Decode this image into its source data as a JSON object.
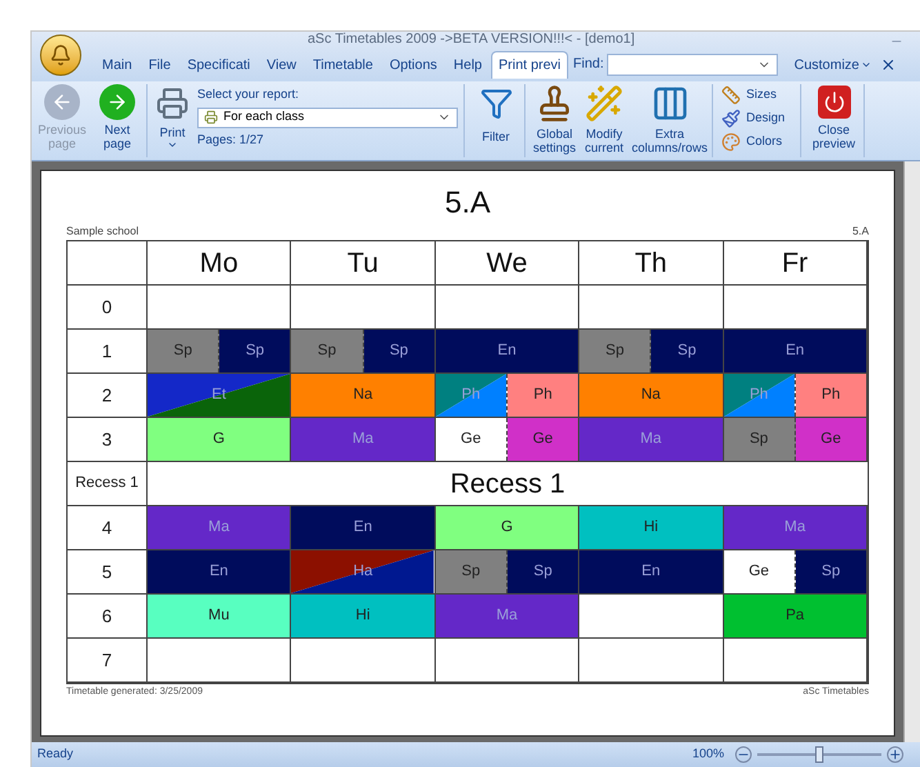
{
  "window": {
    "title": "aSc Timetables 2009 ->BETA VERSION!!!< - [demo1]"
  },
  "menu_tabs": [
    {
      "label": "Main",
      "selected": false
    },
    {
      "label": "File",
      "selected": false
    },
    {
      "label": "Specificati",
      "selected": false
    },
    {
      "label": "View",
      "selected": false
    },
    {
      "label": "Timetable",
      "selected": false
    },
    {
      "label": "Options",
      "selected": false
    },
    {
      "label": "Help",
      "selected": false
    },
    {
      "label": "Print previ",
      "selected": true
    }
  ],
  "find": {
    "label": "Find:"
  },
  "customize": {
    "label": "Customize"
  },
  "ribbon": {
    "nav": [
      {
        "kind": "previous",
        "label": "Previous page",
        "disabled": true
      },
      {
        "kind": "next",
        "label": "Next page",
        "disabled": false
      }
    ],
    "print": {
      "label": "Print",
      "report_label": "Select your report:",
      "report_value": "For each class",
      "pages": "Pages: 1/27"
    },
    "filter": "Filter",
    "settings": [
      {
        "kind": "stamp",
        "label": "Global settings"
      },
      {
        "kind": "wand",
        "label": "Modify current"
      },
      {
        "kind": "columns",
        "label": "Extra columns/rows"
      }
    ],
    "format": [
      {
        "kind": "sizes",
        "label": "Sizes"
      },
      {
        "kind": "design",
        "label": "Design"
      },
      {
        "kind": "colors",
        "label": "Colors"
      }
    ],
    "close": "Close preview"
  },
  "page": {
    "title": "5.A",
    "school": "Sample school",
    "class_tag": "5.A",
    "footer_left": "Timetable generated: 3/25/2009",
    "footer_right": "aSc Timetables",
    "days": [
      "Mo",
      "Tu",
      "We",
      "Th",
      "Fr"
    ],
    "rows": [
      {
        "kind": "period",
        "label": "0",
        "cells": [
          [],
          [],
          [],
          [],
          []
        ]
      },
      {
        "kind": "period",
        "label": "1",
        "cells": [
          [
            {
              "subject": "Sp",
              "color": "#808080"
            },
            {
              "subject": "Sp",
              "color": "#000c5c"
            }
          ],
          [
            {
              "subject": "Sp",
              "color": "#808080"
            },
            {
              "subject": "Sp",
              "color": "#000c5c"
            }
          ],
          [
            {
              "subject": "En",
              "color": "#000c5c"
            }
          ],
          [
            {
              "subject": "Sp",
              "color": "#808080"
            },
            {
              "subject": "Sp",
              "color": "#000c5c"
            }
          ],
          [
            {
              "subject": "En",
              "color": "#000c5c"
            }
          ]
        ]
      },
      {
        "kind": "period",
        "label": "2",
        "cells": [
          [
            {
              "subject": "Et",
              "color": "#1428c8",
              "lower_triangle": {
                "color": "#0a640a"
              }
            }
          ],
          [
            {
              "subject": "Na",
              "color": "#ff8000"
            }
          ],
          [
            {
              "subject": "Ph",
              "color": "#008080",
              "lower_triangle": {
                "color": "#0080ff"
              }
            },
            {
              "subject": "Ph",
              "color": "#ff8080"
            }
          ],
          [
            {
              "subject": "Na",
              "color": "#ff8000"
            }
          ],
          [
            {
              "subject": "Ph",
              "color": "#008080",
              "lower_triangle": {
                "color": "#0080ff"
              }
            },
            {
              "subject": "Ph",
              "color": "#ff8080"
            }
          ]
        ]
      },
      {
        "kind": "period",
        "label": "3",
        "cells": [
          [
            {
              "subject": "G",
              "color": "#80ff80"
            }
          ],
          [
            {
              "subject": "Ma",
              "color": "#6428c8"
            }
          ],
          [
            {
              "subject": "Ge",
              "color": "#ffffff"
            },
            {
              "subject": "Ge",
              "color": "#d030c8"
            }
          ],
          [
            {
              "subject": "Ma",
              "color": "#6428c8"
            }
          ],
          [
            {
              "subject": "Sp",
              "color": "#808080"
            },
            {
              "subject": "Ge",
              "color": "#d030c8"
            }
          ]
        ]
      },
      {
        "kind": "recess",
        "label": "Recess 1",
        "text": "Recess 1"
      },
      {
        "kind": "period",
        "label": "4",
        "cells": [
          [
            {
              "subject": "Ma",
              "color": "#6428c8"
            }
          ],
          [
            {
              "subject": "En",
              "color": "#000c5c"
            }
          ],
          [
            {
              "subject": "G",
              "color": "#80ff80"
            }
          ],
          [
            {
              "subject": "Hi",
              "color": "#00c0c0"
            }
          ],
          [
            {
              "subject": "Ma",
              "color": "#6428c8"
            }
          ]
        ]
      },
      {
        "kind": "period",
        "label": "5",
        "cells": [
          [
            {
              "subject": "En",
              "color": "#000c5c"
            }
          ],
          [
            {
              "subject": "Ha",
              "color": "#8c1000",
              "lower_triangle": {
                "color": "#001890"
              }
            }
          ],
          [
            {
              "subject": "Sp",
              "color": "#808080"
            },
            {
              "subject": "Sp",
              "color": "#000c5c"
            }
          ],
          [
            {
              "subject": "En",
              "color": "#000c5c"
            }
          ],
          [
            {
              "subject": "Ge",
              "color": "#ffffff"
            },
            {
              "subject": "Sp",
              "color": "#000c5c"
            }
          ]
        ]
      },
      {
        "kind": "period",
        "label": "6",
        "cells": [
          [
            {
              "subject": "Mu",
              "color": "#58ffc0"
            }
          ],
          [
            {
              "subject": "Hi",
              "color": "#00c0c0"
            }
          ],
          [
            {
              "subject": "Ma",
              "color": "#6428c8"
            }
          ],
          [],
          [
            {
              "subject": "Pa",
              "color": "#00c030"
            }
          ]
        ]
      },
      {
        "kind": "period",
        "label": "7",
        "cells": [
          [],
          [],
          [],
          [],
          []
        ]
      }
    ]
  },
  "status_bar": {
    "text": "Ready",
    "zoom": "100%",
    "zoom_level": {
      "level": 0.5
    }
  }
}
